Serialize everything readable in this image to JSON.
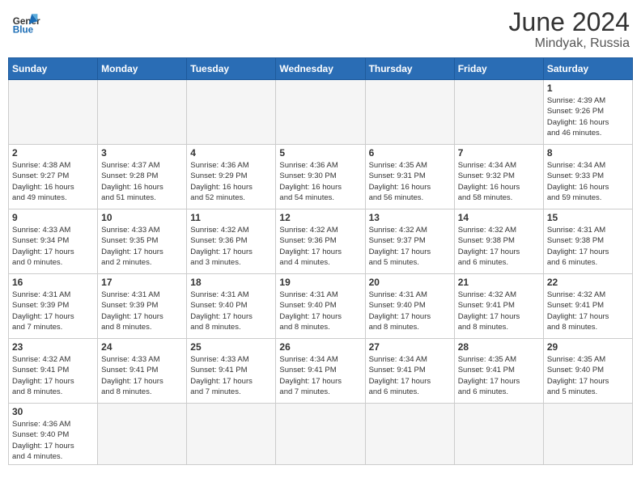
{
  "header": {
    "logo_general": "General",
    "logo_blue": "Blue",
    "month_year": "June 2024",
    "location": "Mindyak, Russia"
  },
  "weekdays": [
    "Sunday",
    "Monday",
    "Tuesday",
    "Wednesday",
    "Thursday",
    "Friday",
    "Saturday"
  ],
  "weeks": [
    [
      {
        "day": "",
        "info": ""
      },
      {
        "day": "",
        "info": ""
      },
      {
        "day": "",
        "info": ""
      },
      {
        "day": "",
        "info": ""
      },
      {
        "day": "",
        "info": ""
      },
      {
        "day": "",
        "info": ""
      },
      {
        "day": "1",
        "info": "Sunrise: 4:39 AM\nSunset: 9:26 PM\nDaylight: 16 hours\nand 46 minutes."
      }
    ],
    [
      {
        "day": "2",
        "info": "Sunrise: 4:38 AM\nSunset: 9:27 PM\nDaylight: 16 hours\nand 49 minutes."
      },
      {
        "day": "3",
        "info": "Sunrise: 4:37 AM\nSunset: 9:28 PM\nDaylight: 16 hours\nand 51 minutes."
      },
      {
        "day": "4",
        "info": "Sunrise: 4:36 AM\nSunset: 9:29 PM\nDaylight: 16 hours\nand 52 minutes."
      },
      {
        "day": "5",
        "info": "Sunrise: 4:36 AM\nSunset: 9:30 PM\nDaylight: 16 hours\nand 54 minutes."
      },
      {
        "day": "6",
        "info": "Sunrise: 4:35 AM\nSunset: 9:31 PM\nDaylight: 16 hours\nand 56 minutes."
      },
      {
        "day": "7",
        "info": "Sunrise: 4:34 AM\nSunset: 9:32 PM\nDaylight: 16 hours\nand 58 minutes."
      },
      {
        "day": "8",
        "info": "Sunrise: 4:34 AM\nSunset: 9:33 PM\nDaylight: 16 hours\nand 59 minutes."
      }
    ],
    [
      {
        "day": "9",
        "info": "Sunrise: 4:33 AM\nSunset: 9:34 PM\nDaylight: 17 hours\nand 0 minutes."
      },
      {
        "day": "10",
        "info": "Sunrise: 4:33 AM\nSunset: 9:35 PM\nDaylight: 17 hours\nand 2 minutes."
      },
      {
        "day": "11",
        "info": "Sunrise: 4:32 AM\nSunset: 9:36 PM\nDaylight: 17 hours\nand 3 minutes."
      },
      {
        "day": "12",
        "info": "Sunrise: 4:32 AM\nSunset: 9:36 PM\nDaylight: 17 hours\nand 4 minutes."
      },
      {
        "day": "13",
        "info": "Sunrise: 4:32 AM\nSunset: 9:37 PM\nDaylight: 17 hours\nand 5 minutes."
      },
      {
        "day": "14",
        "info": "Sunrise: 4:32 AM\nSunset: 9:38 PM\nDaylight: 17 hours\nand 6 minutes."
      },
      {
        "day": "15",
        "info": "Sunrise: 4:31 AM\nSunset: 9:38 PM\nDaylight: 17 hours\nand 6 minutes."
      }
    ],
    [
      {
        "day": "16",
        "info": "Sunrise: 4:31 AM\nSunset: 9:39 PM\nDaylight: 17 hours\nand 7 minutes."
      },
      {
        "day": "17",
        "info": "Sunrise: 4:31 AM\nSunset: 9:39 PM\nDaylight: 17 hours\nand 8 minutes."
      },
      {
        "day": "18",
        "info": "Sunrise: 4:31 AM\nSunset: 9:40 PM\nDaylight: 17 hours\nand 8 minutes."
      },
      {
        "day": "19",
        "info": "Sunrise: 4:31 AM\nSunset: 9:40 PM\nDaylight: 17 hours\nand 8 minutes."
      },
      {
        "day": "20",
        "info": "Sunrise: 4:31 AM\nSunset: 9:40 PM\nDaylight: 17 hours\nand 8 minutes."
      },
      {
        "day": "21",
        "info": "Sunrise: 4:32 AM\nSunset: 9:41 PM\nDaylight: 17 hours\nand 8 minutes."
      },
      {
        "day": "22",
        "info": "Sunrise: 4:32 AM\nSunset: 9:41 PM\nDaylight: 17 hours\nand 8 minutes."
      }
    ],
    [
      {
        "day": "23",
        "info": "Sunrise: 4:32 AM\nSunset: 9:41 PM\nDaylight: 17 hours\nand 8 minutes."
      },
      {
        "day": "24",
        "info": "Sunrise: 4:33 AM\nSunset: 9:41 PM\nDaylight: 17 hours\nand 8 minutes."
      },
      {
        "day": "25",
        "info": "Sunrise: 4:33 AM\nSunset: 9:41 PM\nDaylight: 17 hours\nand 7 minutes."
      },
      {
        "day": "26",
        "info": "Sunrise: 4:34 AM\nSunset: 9:41 PM\nDaylight: 17 hours\nand 7 minutes."
      },
      {
        "day": "27",
        "info": "Sunrise: 4:34 AM\nSunset: 9:41 PM\nDaylight: 17 hours\nand 6 minutes."
      },
      {
        "day": "28",
        "info": "Sunrise: 4:35 AM\nSunset: 9:41 PM\nDaylight: 17 hours\nand 6 minutes."
      },
      {
        "day": "29",
        "info": "Sunrise: 4:35 AM\nSunset: 9:40 PM\nDaylight: 17 hours\nand 5 minutes."
      }
    ],
    [
      {
        "day": "30",
        "info": "Sunrise: 4:36 AM\nSunset: 9:40 PM\nDaylight: 17 hours\nand 4 minutes."
      },
      {
        "day": "",
        "info": ""
      },
      {
        "day": "",
        "info": ""
      },
      {
        "day": "",
        "info": ""
      },
      {
        "day": "",
        "info": ""
      },
      {
        "day": "",
        "info": ""
      },
      {
        "day": "",
        "info": ""
      }
    ]
  ]
}
